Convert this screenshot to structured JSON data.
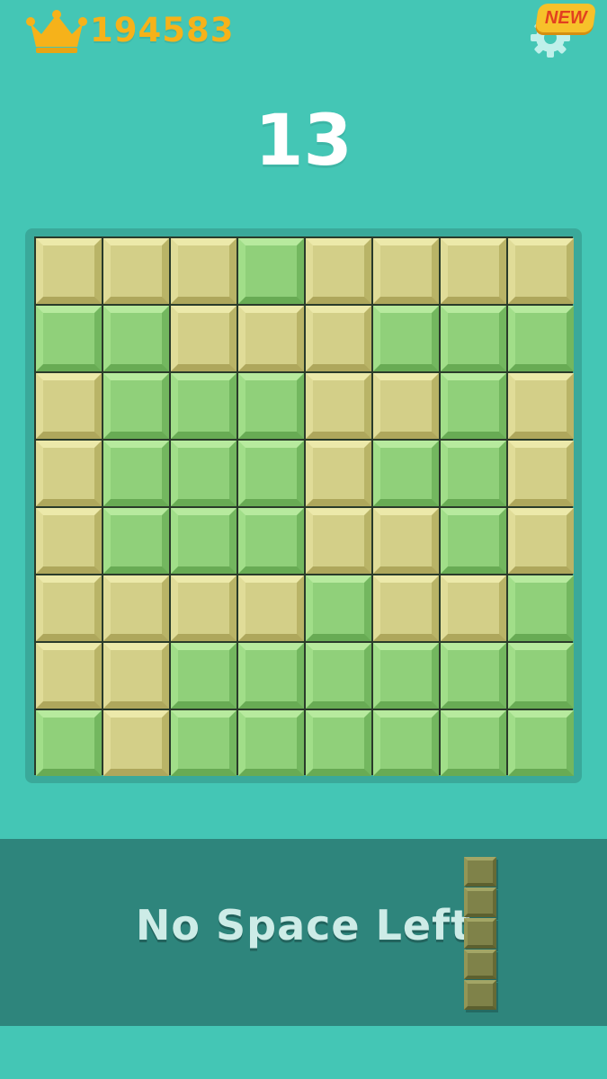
{
  "header": {
    "best_score": "194583",
    "crown_icon": "crown-icon",
    "settings_icon": "gear-icon",
    "new_badge": "NEW"
  },
  "score": "13",
  "board": {
    "rows": [
      [
        "yellow",
        "yellow",
        "yellow",
        "green",
        "yellow",
        "yellow",
        "yellow",
        "yellow"
      ],
      [
        "green",
        "green",
        "yellow",
        "yellow",
        "yellow",
        "green",
        "green",
        "green"
      ],
      [
        "yellow",
        "green",
        "green",
        "green",
        "yellow",
        "yellow",
        "green",
        "yellow"
      ],
      [
        "yellow",
        "green",
        "green",
        "green",
        "yellow",
        "green",
        "green",
        "yellow"
      ],
      [
        "yellow",
        "green",
        "green",
        "green",
        "yellow",
        "yellow",
        "green",
        "yellow"
      ],
      [
        "yellow",
        "yellow",
        "yellow",
        "yellow",
        "green",
        "yellow",
        "yellow",
        "green"
      ],
      [
        "yellow",
        "yellow",
        "green",
        "green",
        "green",
        "green",
        "green",
        "green"
      ],
      [
        "green",
        "yellow",
        "green",
        "green",
        "green",
        "green",
        "green",
        "green"
      ]
    ]
  },
  "tray": {
    "message": "No Space Left",
    "piece_blocks": 5
  },
  "colors": {
    "background": "#44c6b5",
    "score_gold": "#f6b21a",
    "tile_yellow": "#d3cf88",
    "tile_green": "#90d07a",
    "tray": "#2e857c"
  }
}
